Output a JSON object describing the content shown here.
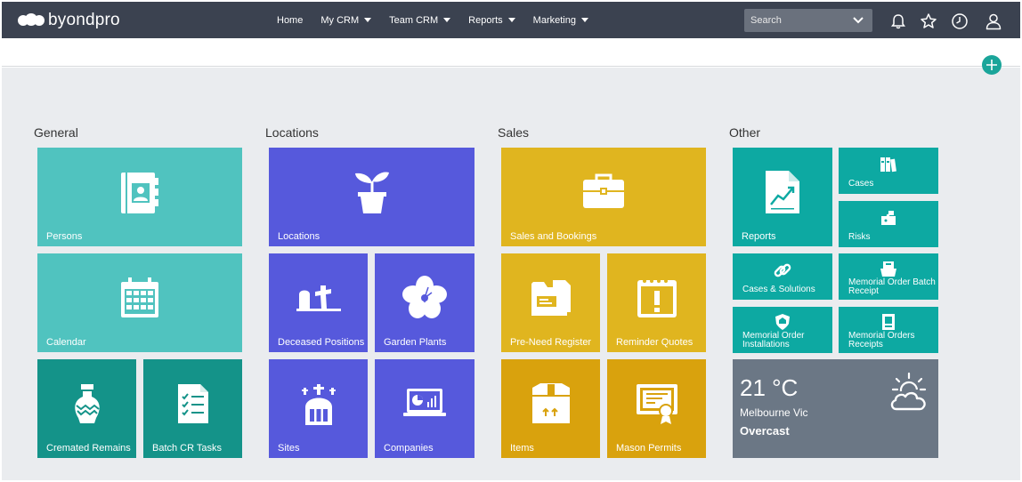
{
  "brand": {
    "name": "byondpro"
  },
  "nav": {
    "items": [
      {
        "label": "Home",
        "dropdown": false
      },
      {
        "label": "My CRM",
        "dropdown": true
      },
      {
        "label": "Team CRM",
        "dropdown": true
      },
      {
        "label": "Reports",
        "dropdown": true
      },
      {
        "label": "Marketing",
        "dropdown": true
      }
    ]
  },
  "search": {
    "placeholder": "Search"
  },
  "sections": {
    "general": "General",
    "locations": "Locations",
    "sales": "Sales",
    "other": "Other"
  },
  "tiles": {
    "persons": "Persons",
    "calendar": "Calendar",
    "cremated_remains": "Cremated Remains",
    "batch_cr_tasks": "Batch CR Tasks",
    "locations": "Locations",
    "deceased_positions": "Deceased Positions",
    "garden_plants": "Garden Plants",
    "sites": "Sites",
    "companies": "Companies",
    "sales_and_bookings": "Sales and Bookings",
    "pre_need_register": "Pre-Need Register",
    "reminder_quotes": "Reminder Quotes",
    "items": "Items",
    "mason_permits": "Mason Permits",
    "reports": "Reports",
    "cases": "Cases",
    "risks": "Risks",
    "cases_solutions": "Cases & Solutions",
    "memorial_order_batch_receipt_1": "Memorial Order Batch",
    "memorial_order_batch_receipt_2": "Receipt",
    "memorial_order_installations_1": "Memorial Order",
    "memorial_order_installations_2": "Installations",
    "memorial_orders_receipts_1": "Memorial Orders",
    "memorial_orders_receipts_2": "Receipts"
  },
  "weather": {
    "temperature": "21 °C",
    "city": "Melbourne Vic",
    "condition": "Overcast"
  },
  "colors": {
    "topbar": "#3b4250",
    "teal_light": "#50c3bf",
    "teal_dark": "#149389",
    "purple": "#5659dc",
    "gold": "#e0b51f",
    "gold_dark": "#d9a20d",
    "teal": "#0da9a2",
    "slate": "#6b7785",
    "accent": "#1aa59a"
  },
  "icons": {
    "top": [
      "bell-icon",
      "star-icon",
      "clock-icon",
      "user-icon"
    ],
    "add": "plus-icon"
  }
}
